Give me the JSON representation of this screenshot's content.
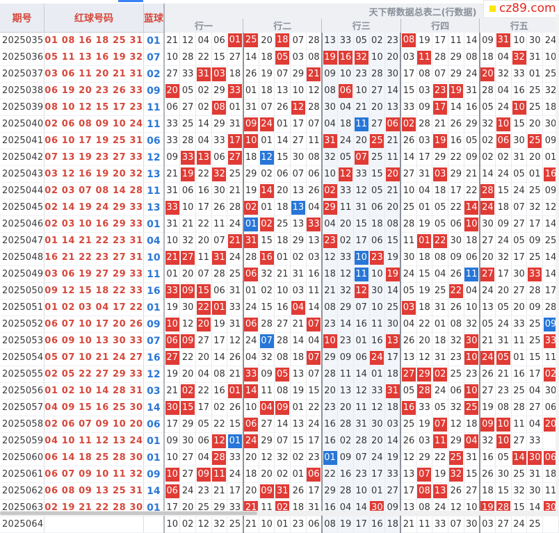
{
  "header": {
    "col_period": "期号",
    "col_red": "红球号码",
    "col_blue": "蓝球",
    "title": "天下帮数据总表二(行数据)",
    "groups": [
      "行一",
      "行二",
      "行三",
      "行四",
      "行五"
    ]
  },
  "logo": {
    "text": "cz89.com"
  },
  "rows": [
    {
      "period": "2025035",
      "red": "01 08 16 18 25 31",
      "blue": "01",
      "nums": [
        "21",
        "12",
        "04",
        "06",
        "01",
        "25",
        "20",
        "18",
        "07",
        "28",
        "13",
        "33",
        "05",
        "02",
        "23",
        "08",
        "19",
        "17",
        "11",
        "14",
        "09",
        "31",
        "10",
        "30",
        "24"
      ],
      "hits": [
        4,
        5,
        7,
        20,
        21
      ],
      "grey": [
        4
      ]
    },
    {
      "period": "2025036",
      "red": "05 11 13 16 19 32",
      "blue": "07",
      "nums": [
        "10",
        "28",
        "22",
        "15",
        "27",
        "14",
        "18",
        "05",
        "03",
        "08",
        "19",
        "16",
        "32",
        "10",
        "20",
        "03",
        "11",
        "28",
        "29",
        "08",
        "18",
        "04",
        "32",
        "31",
        "10"
      ],
      "hits": [],
      "grey": []
    },
    {
      "period": "2025037",
      "red": "03 06 11 20 21 31",
      "blue": "02",
      "nums": [
        "27",
        "33",
        "31",
        "03",
        "18",
        "26",
        "19",
        "07",
        "29",
        "21",
        "09",
        "10",
        "23",
        "28",
        "30",
        "17",
        "08",
        "07",
        "29",
        "24",
        "20",
        "32",
        "33",
        "01",
        "25"
      ],
      "hits": [],
      "grey": []
    },
    {
      "period": "2025038",
      "red": "06 19 20 23 26 33",
      "blue": "09",
      "nums": [
        "20",
        "05",
        "02",
        "29",
        "33",
        "01",
        "18",
        "13",
        "10",
        "12",
        "08",
        "06",
        "10",
        "27",
        "14",
        "15",
        "03",
        "23",
        "19",
        "31",
        "28",
        "04",
        "16",
        "25",
        "32"
      ],
      "hits": [],
      "grey": []
    },
    {
      "period": "2025039",
      "red": "08 10 12 15 17 23",
      "blue": "11",
      "nums": [
        "06",
        "27",
        "02",
        "08",
        "01",
        "31",
        "07",
        "26",
        "12",
        "28",
        "30",
        "04",
        "21",
        "20",
        "13",
        "33",
        "09",
        "17",
        "14",
        "16",
        "05",
        "24",
        "10",
        "25",
        "18"
      ],
      "hits": [],
      "grey": []
    },
    {
      "period": "2025040",
      "red": "02 06 08 09 10 24",
      "blue": "11",
      "nums": [
        "33",
        "25",
        "14",
        "29",
        "31",
        "09",
        "24",
        "01",
        "17",
        "07",
        "04",
        "18",
        "11",
        "27",
        "06",
        "02",
        "28",
        "21",
        "26",
        "29",
        "32",
        "10",
        "15",
        "20",
        "30"
      ],
      "hits": [],
      "grey": []
    },
    {
      "period": "2025041",
      "red": "06 10 17 19 25 31",
      "blue": "06",
      "nums": [
        "33",
        "28",
        "04",
        "33",
        "17",
        "10",
        "01",
        "14",
        "27",
        "11",
        "31",
        "24",
        "20",
        "25",
        "21",
        "26",
        "03",
        "19",
        "16",
        "05",
        "02",
        "06",
        "30",
        "25",
        "09"
      ],
      "hits": [],
      "grey": []
    },
    {
      "period": "2025042",
      "red": "07 13 19 23 27 33",
      "blue": "12",
      "nums": [
        "09",
        "33",
        "13",
        "06",
        "27",
        "18",
        "12",
        "15",
        "30",
        "08",
        "32",
        "05",
        "07",
        "25",
        "11",
        "14",
        "17",
        "29",
        "22",
        "09",
        "02",
        "02",
        "31",
        "20",
        "01"
      ],
      "hits": [],
      "grey": []
    },
    {
      "period": "2025043",
      "red": "03 12 16 19 20 32",
      "blue": "13",
      "nums": [
        "21",
        "19",
        "22",
        "32",
        "25",
        "29",
        "02",
        "06",
        "07",
        "06",
        "10",
        "12",
        "33",
        "15",
        "20",
        "27",
        "31",
        "03",
        "29",
        "21",
        "14",
        "24",
        "05",
        "01",
        "16"
      ],
      "hits": [],
      "grey": []
    },
    {
      "period": "2025044",
      "red": "02 03 07 08 14 28",
      "blue": "11",
      "nums": [
        "31",
        "06",
        "16",
        "30",
        "21",
        "19",
        "14",
        "20",
        "13",
        "26",
        "02",
        "33",
        "12",
        "05",
        "21",
        "10",
        "04",
        "18",
        "17",
        "22",
        "28",
        "15",
        "24",
        "25",
        "09"
      ],
      "hits": [],
      "grey": []
    },
    {
      "period": "2025045",
      "red": "02 14 19 24 29 33",
      "blue": "13",
      "nums": [
        "33",
        "10",
        "17",
        "26",
        "28",
        "02",
        "01",
        "18",
        "13",
        "04",
        "29",
        "11",
        "31",
        "06",
        "20",
        "25",
        "01",
        "05",
        "22",
        "14",
        "24",
        "18",
        "07",
        "32",
        "12"
      ],
      "hits": [],
      "grey": []
    },
    {
      "period": "2025046",
      "red": "02 03 10 16 29 33",
      "blue": "01",
      "nums": [
        "31",
        "21",
        "22",
        "11",
        "24",
        "01",
        "02",
        "25",
        "13",
        "33",
        "04",
        "20",
        "15",
        "18",
        "08",
        "28",
        "19",
        "05",
        "06",
        "10",
        "30",
        "09",
        "27",
        "17",
        "14"
      ],
      "hits": [],
      "grey": []
    },
    {
      "period": "2025047",
      "red": "01 14 21 22 23 31",
      "blue": "04",
      "nums": [
        "10",
        "32",
        "20",
        "07",
        "21",
        "31",
        "15",
        "18",
        "29",
        "13",
        "23",
        "02",
        "17",
        "06",
        "15",
        "11",
        "01",
        "22",
        "30",
        "18",
        "27",
        "24",
        "05",
        "09",
        "25"
      ],
      "hits": [],
      "grey": []
    },
    {
      "period": "2025048",
      "red": "16 21 22 23 27 31",
      "blue": "10",
      "nums": [
        "21",
        "27",
        "11",
        "31",
        "24",
        "28",
        "16",
        "01",
        "02",
        "03",
        "12",
        "33",
        "10",
        "23",
        "19",
        "30",
        "18",
        "08",
        "09",
        "06",
        "20",
        "32",
        "17",
        "25",
        "14"
      ],
      "hits": [],
      "grey": []
    },
    {
      "period": "2025049",
      "red": "03 06 19 27 29 33",
      "blue": "11",
      "nums": [
        "01",
        "20",
        "07",
        "28",
        "25",
        "06",
        "32",
        "21",
        "31",
        "16",
        "18",
        "12",
        "11",
        "10",
        "19",
        "24",
        "15",
        "04",
        "26",
        "11",
        "27",
        "17",
        "30",
        "33",
        "14"
      ],
      "hits": [],
      "grey": []
    },
    {
      "period": "2025050",
      "red": "09 12 15 18 22 33",
      "blue": "16",
      "nums": [
        "33",
        "09",
        "15",
        "06",
        "31",
        "01",
        "02",
        "10",
        "03",
        "11",
        "21",
        "32",
        "12",
        "30",
        "14",
        "05",
        "19",
        "25",
        "22",
        "04",
        "24",
        "20",
        "27",
        "28",
        "17"
      ],
      "hits": [],
      "grey": []
    },
    {
      "period": "2025051",
      "red": "01 02 03 04 17 22",
      "blue": "01",
      "nums": [
        "19",
        "30",
        "22",
        "01",
        "33",
        "24",
        "15",
        "16",
        "04",
        "14",
        "08",
        "29",
        "07",
        "10",
        "25",
        "03",
        "18",
        "31",
        "26",
        "10",
        "13",
        "05",
        "20",
        "09",
        "28"
      ],
      "hits": [],
      "grey": []
    },
    {
      "period": "2025052",
      "red": "06 07 10 17 20 26",
      "blue": "09",
      "nums": [
        "10",
        "12",
        "20",
        "19",
        "31",
        "06",
        "28",
        "27",
        "21",
        "07",
        "23",
        "14",
        "16",
        "11",
        "30",
        "04",
        "22",
        "01",
        "08",
        "32",
        "05",
        "24",
        "33",
        "25",
        "09"
      ],
      "hits": [],
      "grey": []
    },
    {
      "period": "2025053",
      "red": "06 09 10 13 30 33",
      "blue": "07",
      "nums": [
        "06",
        "09",
        "27",
        "17",
        "12",
        "24",
        "07",
        "28",
        "14",
        "04",
        "10",
        "23",
        "01",
        "16",
        "13",
        "26",
        "20",
        "18",
        "32",
        "30",
        "21",
        "31",
        "11",
        "25",
        "33"
      ],
      "hits": [],
      "grey": []
    },
    {
      "period": "2025054",
      "red": "05 07 10 21 24 27",
      "blue": "16",
      "nums": [
        "27",
        "22",
        "20",
        "14",
        "26",
        "04",
        "32",
        "08",
        "18",
        "07",
        "29",
        "09",
        "06",
        "24",
        "17",
        "13",
        "12",
        "31",
        "23",
        "10",
        "24",
        "05",
        "01",
        "15",
        "11"
      ],
      "hits": [],
      "grey": []
    },
    {
      "period": "2025055",
      "red": "02 05 22 27 29 33",
      "blue": "12",
      "nums": [
        "19",
        "20",
        "04",
        "08",
        "21",
        "33",
        "09",
        "05",
        "13",
        "07",
        "28",
        "11",
        "14",
        "01",
        "18",
        "27",
        "29",
        "02",
        "25",
        "23",
        "26",
        "21",
        "16",
        "17",
        "02"
      ],
      "hits": [],
      "grey": []
    },
    {
      "period": "2025056",
      "red": "01 02 10 14 28 31",
      "blue": "03",
      "nums": [
        "21",
        "02",
        "22",
        "16",
        "01",
        "14",
        "11",
        "08",
        "19",
        "15",
        "20",
        "13",
        "12",
        "33",
        "31",
        "05",
        "28",
        "24",
        "06",
        "10",
        "27",
        "23",
        "25",
        "04",
        "30"
      ],
      "hits": [],
      "grey": []
    },
    {
      "period": "2025057",
      "red": "04 09 15 16 25 30",
      "blue": "14",
      "nums": [
        "30",
        "15",
        "17",
        "02",
        "26",
        "10",
        "04",
        "09",
        "01",
        "22",
        "23",
        "20",
        "11",
        "12",
        "18",
        "16",
        "33",
        "05",
        "32",
        "25",
        "19",
        "08",
        "28",
        "27",
        "06"
      ],
      "hits": [],
      "grey": []
    },
    {
      "period": "2025058",
      "red": "02 06 07 09 10 20",
      "blue": "06",
      "nums": [
        "17",
        "29",
        "05",
        "22",
        "15",
        "06",
        "27",
        "14",
        "13",
        "24",
        "16",
        "28",
        "31",
        "30",
        "03",
        "25",
        "19",
        "07",
        "12",
        "18",
        "09",
        "10",
        "11",
        "04",
        "20"
      ],
      "hits": [],
      "grey": []
    },
    {
      "period": "2025059",
      "red": "04 10 11 12 13 24",
      "blue": "01",
      "nums": [
        "09",
        "30",
        "06",
        "12",
        "01",
        "24",
        "29",
        "07",
        "15",
        "17",
        "16",
        "02",
        "28",
        "20",
        "14",
        "26",
        "03",
        "11",
        "29",
        "04",
        "32",
        "10",
        "27",
        "33"
      ],
      "hits": [],
      "grey": []
    },
    {
      "period": "2025060",
      "red": "06 14 18 25 28 30",
      "blue": "01",
      "nums": [
        "10",
        "27",
        "04",
        "28",
        "33",
        "20",
        "12",
        "32",
        "02",
        "23",
        "01",
        "09",
        "07",
        "24",
        "19",
        "12",
        "29",
        "22",
        "25",
        "31",
        "16",
        "05",
        "14",
        "30",
        "06"
      ],
      "hits": [],
      "grey": []
    },
    {
      "period": "2025061",
      "red": "06 07 09 10 11 32",
      "blue": "09",
      "nums": [
        "10",
        "27",
        "09",
        "11",
        "24",
        "18",
        "20",
        "02",
        "01",
        "06",
        "22",
        "16",
        "23",
        "17",
        "33",
        "13",
        "07",
        "19",
        "32",
        "15",
        "26",
        "30",
        "25",
        "31",
        "18"
      ],
      "hits": [],
      "grey": []
    },
    {
      "period": "2025062",
      "red": "06 08 09 13 25 31",
      "blue": "14",
      "nums": [
        "06",
        "24",
        "23",
        "21",
        "17",
        "20",
        "09",
        "31",
        "26",
        "17",
        "29",
        "28",
        "10",
        "01",
        "27",
        "17",
        "08",
        "13",
        "26",
        "27",
        "18",
        "15",
        "32",
        "30",
        "11"
      ],
      "hits": [],
      "grey": []
    },
    {
      "period": "2025063",
      "red": "02 19 21 22 28 30",
      "blue": "01",
      "nums": [
        "17",
        "20",
        "25",
        "29",
        "33",
        "21",
        "11",
        "02",
        "18",
        "31",
        "16",
        "04",
        "14",
        "30",
        "09",
        "13",
        "08",
        "24",
        "12",
        "10",
        "19",
        "28",
        "15",
        "14",
        "30"
      ],
      "hits": [],
      "grey": []
    },
    {
      "period": "2025064",
      "red": "",
      "blue": "",
      "nums": [
        "10",
        "02",
        "12",
        "32",
        "25",
        "21",
        "10",
        "01",
        "23",
        "06",
        "08",
        "19",
        "17",
        "16",
        "18",
        "21",
        "11",
        "33",
        "07",
        "30",
        "03",
        "27",
        "24",
        "25",
        ""
      ],
      "hits": [],
      "grey": []
    }
  ]
}
